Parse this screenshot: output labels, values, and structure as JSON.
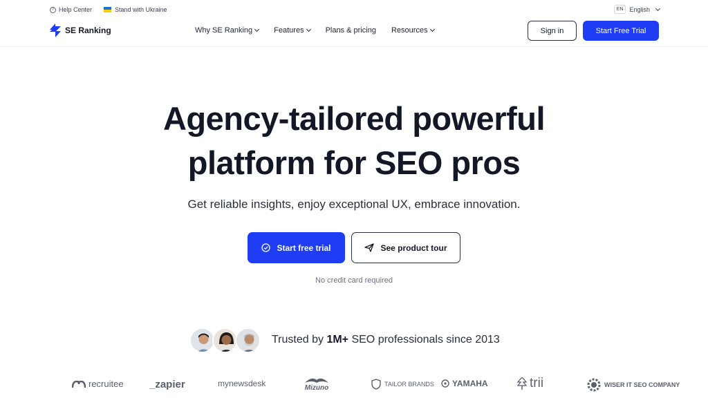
{
  "topbar": {
    "help_label": "Help Center",
    "ukraine_label": "Stand with Ukraine",
    "lang_code": "EN",
    "lang_label": "English"
  },
  "header": {
    "brand": "SE Ranking",
    "nav": [
      {
        "label": "Why SE Ranking",
        "has_dropdown": true
      },
      {
        "label": "Features",
        "has_dropdown": true
      },
      {
        "label": "Plans & pricing",
        "has_dropdown": false
      },
      {
        "label": "Resources",
        "has_dropdown": true
      }
    ],
    "signin_label": "Sign in",
    "trial_label": "Start Free Trial"
  },
  "hero": {
    "title_line1": "Agency-tailored powerful",
    "title_line2": "platform for SEO pros",
    "subtitle": "Get reliable insights, enjoy exceptional UX, embrace innovation.",
    "cta_primary": "Start free trial",
    "cta_secondary": "See product tour",
    "note": "No credit card required"
  },
  "trust": {
    "prefix": "Trusted by ",
    "highlight": "1M+",
    "suffix": " SEO professionals since 2013"
  },
  "logos": [
    "recruitee",
    "_zapier",
    "mynewsdesk",
    "Mizuno",
    "TAILOR BRANDS",
    "YAMAHA",
    "trii",
    "WISER IT SEO COMPANY"
  ],
  "colors": {
    "accent": "#1e3df5",
    "text": "#141826"
  }
}
